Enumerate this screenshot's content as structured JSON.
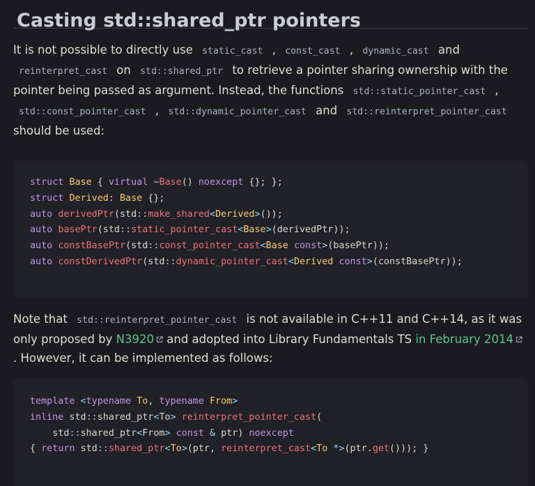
{
  "heading": "Casting std::shared_ptr pointers",
  "para1": {
    "t1": "It is not possible to directly use ",
    "c_static_cast": "static_cast",
    "sep1": " , ",
    "c_const_cast": "const_cast",
    "sep2": " , ",
    "c_dynamic_cast": "dynamic_cast",
    "t_and1": " and ",
    "c_reinterpret_cast": "reinterpret_cast",
    "t_on": " on ",
    "c_shared_ptr": "std::shared_ptr",
    "t2": " to retrieve a pointer sharing ownership with the pointer being passed as argument. Instead, the functions ",
    "c_static_pointer_cast": "std::static_pointer_cast",
    "sep3": " , ",
    "c_const_pointer_cast": "std::const_pointer_cast",
    "sep4": " , ",
    "c_dynamic_pointer_cast": "std::dynamic_pointer_cast",
    "t_and2": " and ",
    "c_reinterpret_pointer_cast": "std::reinterpret_pointer_cast",
    "t3": " should be used:"
  },
  "code1": {
    "l1": {
      "a": "struct",
      "b": " ",
      "c": "Base",
      "d": " { ",
      "e": "virtual",
      "f": " ~",
      "g": "Base",
      "h": "() ",
      "i": "noexcept",
      "j": " {}; };"
    },
    "l2": {
      "a": "struct",
      "b": " ",
      "c": "Derived",
      "d": ": ",
      "e": "Base",
      "f": " {};"
    },
    "l3": {
      "a": "auto",
      "b": " ",
      "c": "derivedPtr",
      "d": "(std",
      "e": "::",
      "f": "make_shared",
      "g": "<",
      "h": "Derived",
      "i": ">",
      "j": "());"
    },
    "l4": {
      "a": "auto",
      "b": " ",
      "c": "basePtr",
      "d": "(std",
      "e": "::",
      "f": "static_pointer_cast",
      "g": "<",
      "h": "Base",
      "i": ">",
      "j": "(derivedPtr));"
    },
    "l5": {
      "a": "auto",
      "b": " ",
      "c": "constBasePtr",
      "d": "(std",
      "e": "::",
      "f": "const_pointer_cast",
      "g": "<",
      "h": "Base",
      "i": " ",
      "j": "const",
      "k": ">",
      "l": "(basePtr));"
    },
    "l6": {
      "a": "auto",
      "b": " ",
      "c": "constDerivedPtr",
      "d": "(std",
      "e": "::",
      "f": "dynamic_pointer_cast",
      "g": "<",
      "h": "Derived",
      "i": " ",
      "j": "const",
      "k": ">",
      "l": "(constBasePtr));"
    }
  },
  "para2": {
    "t1": "Note that ",
    "c_reinterpret_pointer_cast": "std::reinterpret_pointer_cast",
    "t2": " is not available in C++11 and C++14, as it was only proposed by ",
    "link_n3920": "N3920",
    "t3": " and adopted into Library Fundamentals TS ",
    "link_feb2014": "in February 2014",
    "t4": " . However, it can be implemented as follows:"
  },
  "code2": {
    "l1": {
      "a": "template",
      "b": " <",
      "c": "typename",
      "d": " ",
      "e": "To",
      "f": ", ",
      "g": "typename",
      "h": " ",
      "i": "From",
      "j": ">"
    },
    "l2": {
      "a": "inline",
      "b": " std",
      "c": "::",
      "d": "shared_ptr",
      "e": "<",
      "f": "To",
      "g": ">",
      "h": " ",
      "i": "reinterpret_pointer_cast",
      "j": "("
    },
    "l3": {
      "a": "    std",
      "b": "::",
      "c": "shared_ptr",
      "d": "<",
      "e": "From",
      "f": ">",
      "g": " ",
      "h": "const",
      "i": " ",
      "j": "&",
      "k": " ptr) ",
      "l": "noexcept"
    },
    "l4": {
      "a": "{ ",
      "b": "return",
      "c": " std",
      "d": "::",
      "e": "shared_ptr",
      "f": "<",
      "g": "To",
      "h": ">",
      "i": "(ptr, ",
      "j": "reinterpret_cast",
      "k": "<",
      "l": "To",
      "m": " *>",
      "n": "(ptr.",
      "o": "get",
      "p": "())); }"
    }
  },
  "icons": {
    "external_link": "external-link-icon"
  }
}
